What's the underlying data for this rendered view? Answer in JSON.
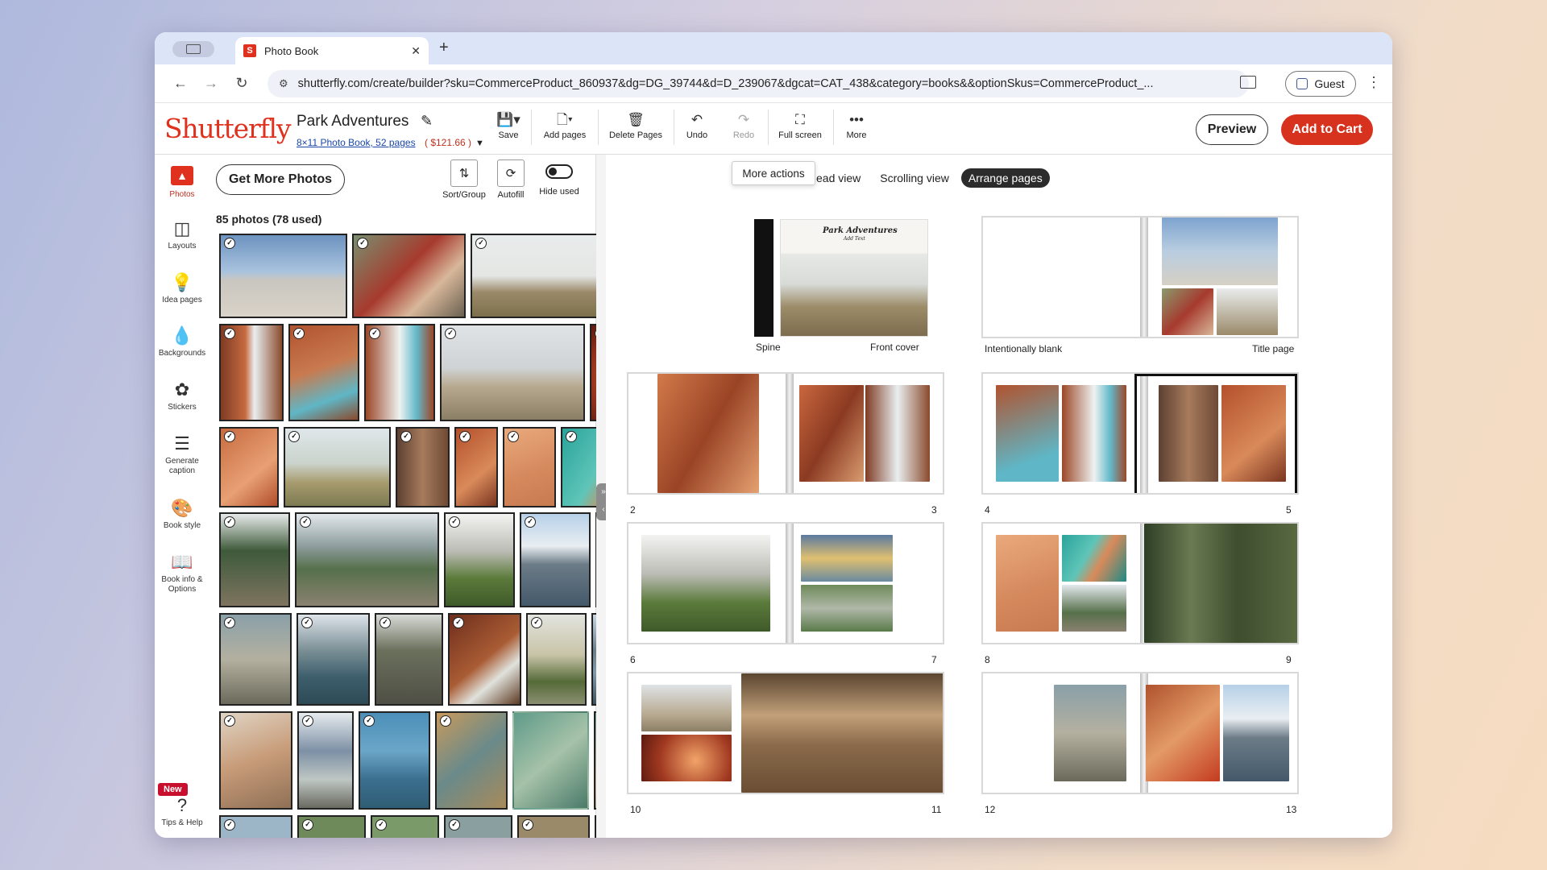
{
  "browser": {
    "tab_title": "Photo Book",
    "tab_close": "✕",
    "new_tab": "+",
    "url": "shutterfly.com/create/builder?sku=CommerceProduct_860937&dg=DG_39744&d=D_239067&dgcat=CAT_438&category=books&&optionSkus=CommerceProduct_...",
    "profile_label": "Guest",
    "favicon_letter": "S"
  },
  "header": {
    "logo": "Shutterfly",
    "project_title": "Park Adventures",
    "project_subtitle": "8×11 Photo Book, 52 pages",
    "project_price": "( $121.66 )",
    "tools": [
      {
        "label": "Save",
        "icon": "save-icon"
      },
      {
        "label": "Add pages",
        "icon": "add-page-icon"
      },
      {
        "label": "Delete Pages",
        "icon": "trash-icon"
      },
      {
        "label": "Undo",
        "icon": "undo-icon"
      },
      {
        "label": "Redo",
        "icon": "redo-icon"
      },
      {
        "label": "Full screen",
        "icon": "fullscreen-icon"
      },
      {
        "label": "More",
        "icon": "more-icon"
      }
    ],
    "preview_label": "Preview",
    "cart_label": "Add to Cart"
  },
  "rail": {
    "items": [
      {
        "label": "Photos"
      },
      {
        "label": "Layouts"
      },
      {
        "label": "Idea pages"
      },
      {
        "label": "Backgrounds"
      },
      {
        "label": "Stickers"
      },
      {
        "label": "Generate caption"
      },
      {
        "label": "Book style"
      },
      {
        "label": "Book info & Options"
      },
      {
        "label": "Tips & Help"
      }
    ],
    "new_badge": "New"
  },
  "photos_panel": {
    "get_more_label": "Get More Photos",
    "sort_label": "Sort/Group",
    "autofill_label": "Autofill",
    "hide_used_label": "Hide used",
    "count_label": "85 photos (78 used)",
    "check_mark": "✓"
  },
  "book_panel": {
    "tooltip": "More actions",
    "view_tabs": [
      "ead view",
      "Scrolling view",
      "Arrange pages"
    ],
    "active_view": "Arrange pages",
    "cover_labels": {
      "spine": "Spine",
      "front": "Front cover",
      "blank": "Intentionally blank",
      "title": "Title page"
    },
    "cover_title": "Park Adventures",
    "cover_sub": "Add Text",
    "page_numbers": [
      "2",
      "3",
      "4",
      "5",
      "6",
      "7",
      "8",
      "9",
      "10",
      "11",
      "12",
      "13"
    ]
  },
  "colors": {
    "brand_red": "#e0301e",
    "cart_red": "#d6321e",
    "active_tab_dark": "#2c2c2c"
  }
}
